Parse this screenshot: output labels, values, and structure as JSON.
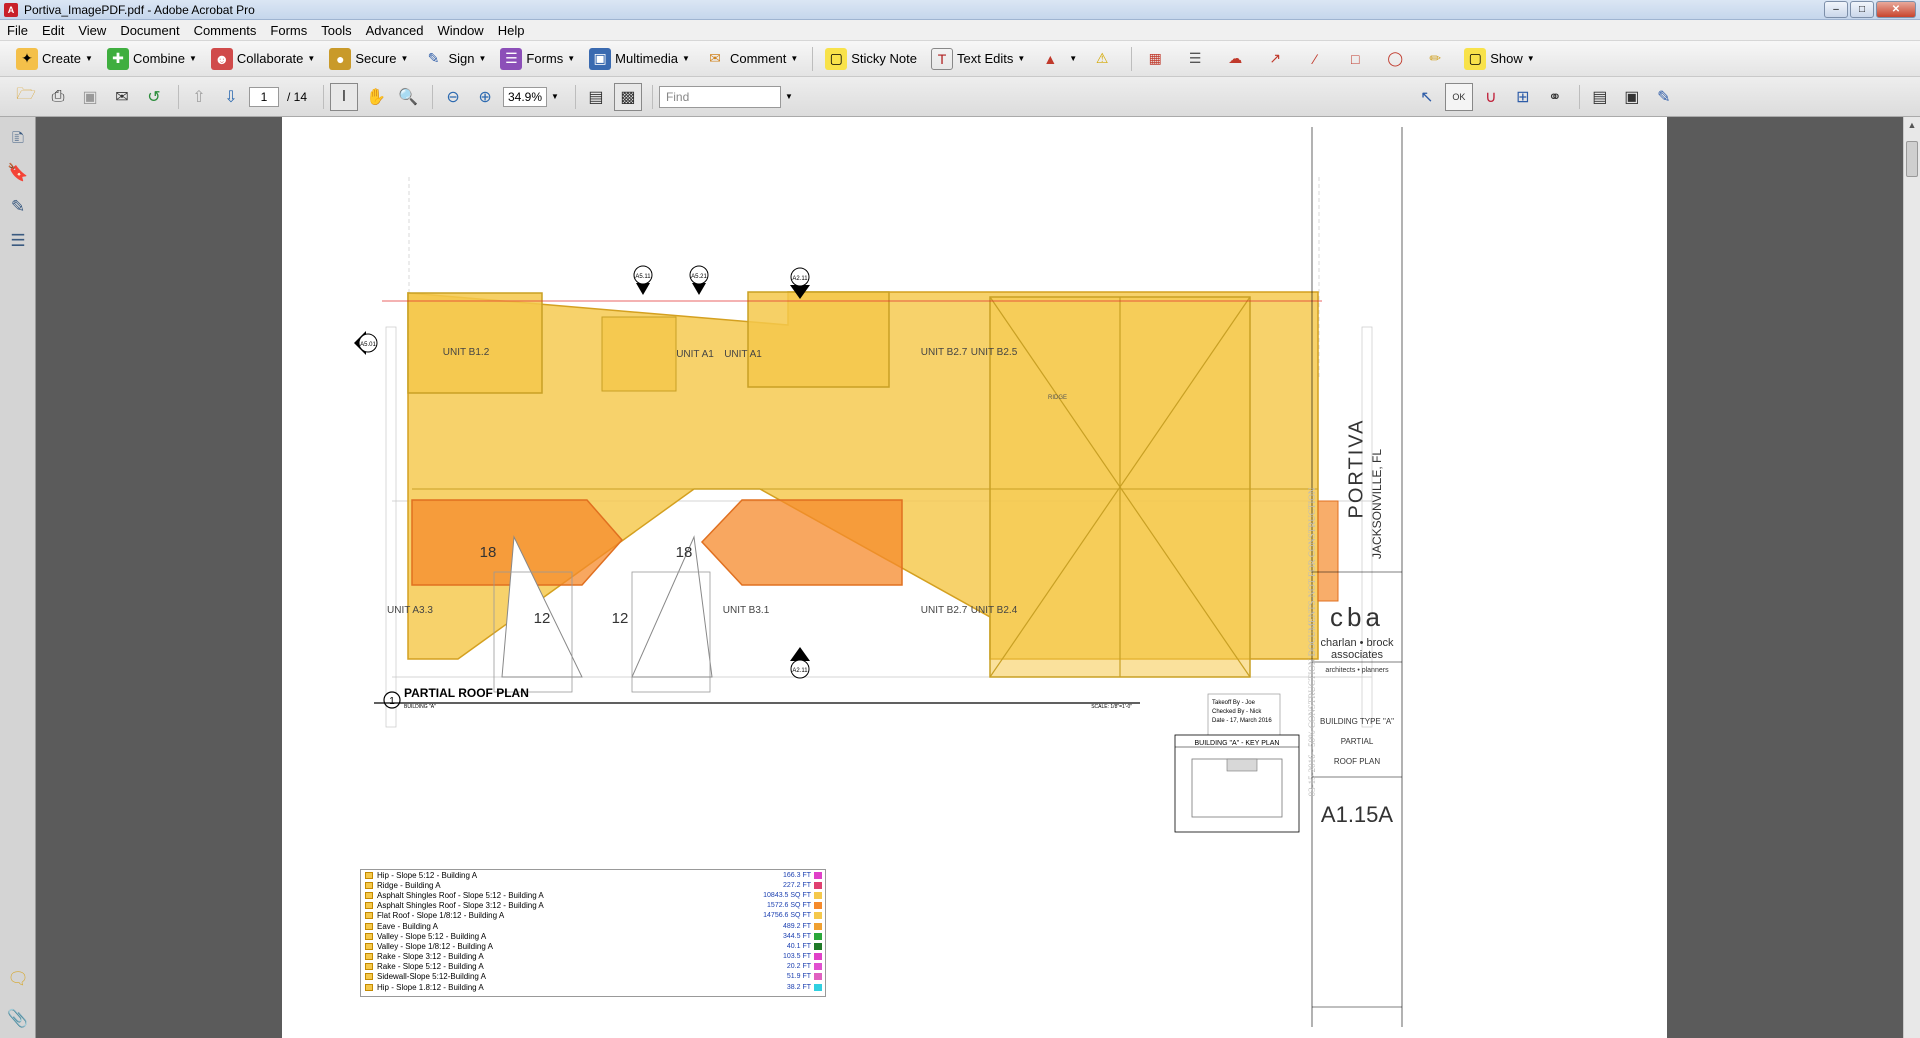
{
  "window": {
    "title": "Portiva_ImagePDF.pdf - Adobe Acrobat Pro",
    "app_icon": "acrobat-icon"
  },
  "menu": [
    "File",
    "Edit",
    "View",
    "Document",
    "Comments",
    "Forms",
    "Tools",
    "Advanced",
    "Window",
    "Help"
  ],
  "toolbar": {
    "create": "Create",
    "combine": "Combine",
    "collaborate": "Collaborate",
    "secure": "Secure",
    "sign": "Sign",
    "forms": "Forms",
    "multimedia": "Multimedia",
    "comment": "Comment",
    "sticky_note": "Sticky Note",
    "text_edits": "Text Edits",
    "show": "Show"
  },
  "nav": {
    "page_current": "1",
    "page_total": "/ 14",
    "zoom": "34.9%",
    "find_placeholder": "Find"
  },
  "drawing": {
    "unit_labels": [
      "UNIT B1.2",
      "UNIT A1",
      "UNIT A1",
      "UNIT B2.7",
      "UNIT B2.5",
      "UNIT A3.3",
      "UNIT B3.1",
      "UNIT B2.7",
      "UNIT B2.4"
    ],
    "area_labels": [
      "18",
      "18",
      "12",
      "12"
    ],
    "section_marks": [
      "A5.11",
      "A5.21",
      "A2.11",
      "A5.01",
      "A2.11"
    ],
    "ridge_label": "RIDGE",
    "plan_title": "PARTIAL ROOF PLAN",
    "plan_subtitle": "BUILDING \"A\"",
    "plan_number": "1",
    "scale": "SCALE: 1/8\"=1'-0\"",
    "key_plan_title": "BUILDING \"A\" - KEY PLAN",
    "takeoff": [
      "Takeoff By - Joe",
      "Checked By - Nick",
      "Date - 17, March 2016"
    ]
  },
  "legend": [
    {
      "label": "Hip - Slope 5:12 - Building A",
      "value": "166.3 FT",
      "color": "#e040c8"
    },
    {
      "label": "Ridge - Building A",
      "value": "227.2 FT",
      "color": "#e04070"
    },
    {
      "label": "Asphalt Shingles Roof - Slope 5:12 - Building A",
      "value": "10843.5 SQ FT",
      "color": "#f5c84b"
    },
    {
      "label": "Asphalt Shingles Roof - Slope 3:12 - Building A",
      "value": "1572.6 SQ FT",
      "color": "#f58a2b"
    },
    {
      "label": "Flat Roof - Slope 1/8:12 - Building A",
      "value": "14756.6 SQ FT",
      "color": "#f5c84b"
    },
    {
      "label": "Eave - Building A",
      "value": "489.2 FT",
      "color": "#f0a030"
    },
    {
      "label": "Valley - Slope 5:12 - Building A",
      "value": "344.5 FT",
      "color": "#2aa83a"
    },
    {
      "label": "Valley - Slope 1/8:12 - Building A",
      "value": "40.1 FT",
      "color": "#207a28"
    },
    {
      "label": "Rake - Slope 3:12 - Building A",
      "value": "103.5 FT",
      "color": "#e040c8"
    },
    {
      "label": "Rake - Slope 5:12 - Building A",
      "value": "20.2 FT",
      "color": "#e050d0"
    },
    {
      "label": "Sidewall-Slope 5:12-Building A",
      "value": "51.9 FT",
      "color": "#e060c0"
    },
    {
      "label": "Hip - Slope 1.8:12 - Building A",
      "value": "38.2 FT",
      "color": "#30d0e0"
    }
  ],
  "title_block": {
    "project": "PORTIVA",
    "location": "JACKSONVILLE, FL",
    "firm_logo": "cba",
    "firm_name": "charlan • brock associates",
    "firm_tag": "architects • planners",
    "sheet_title_1": "BUILDING TYPE \"A\"",
    "sheet_title_2": "PARTIAL",
    "sheet_title_3": "ROOF PLAN",
    "sheet_number": "A1.15A",
    "watermark": "03-15-2016 - 50% CONSTRUCTION DOCUMENTS-NOT FOR CONSTRUCTION"
  }
}
